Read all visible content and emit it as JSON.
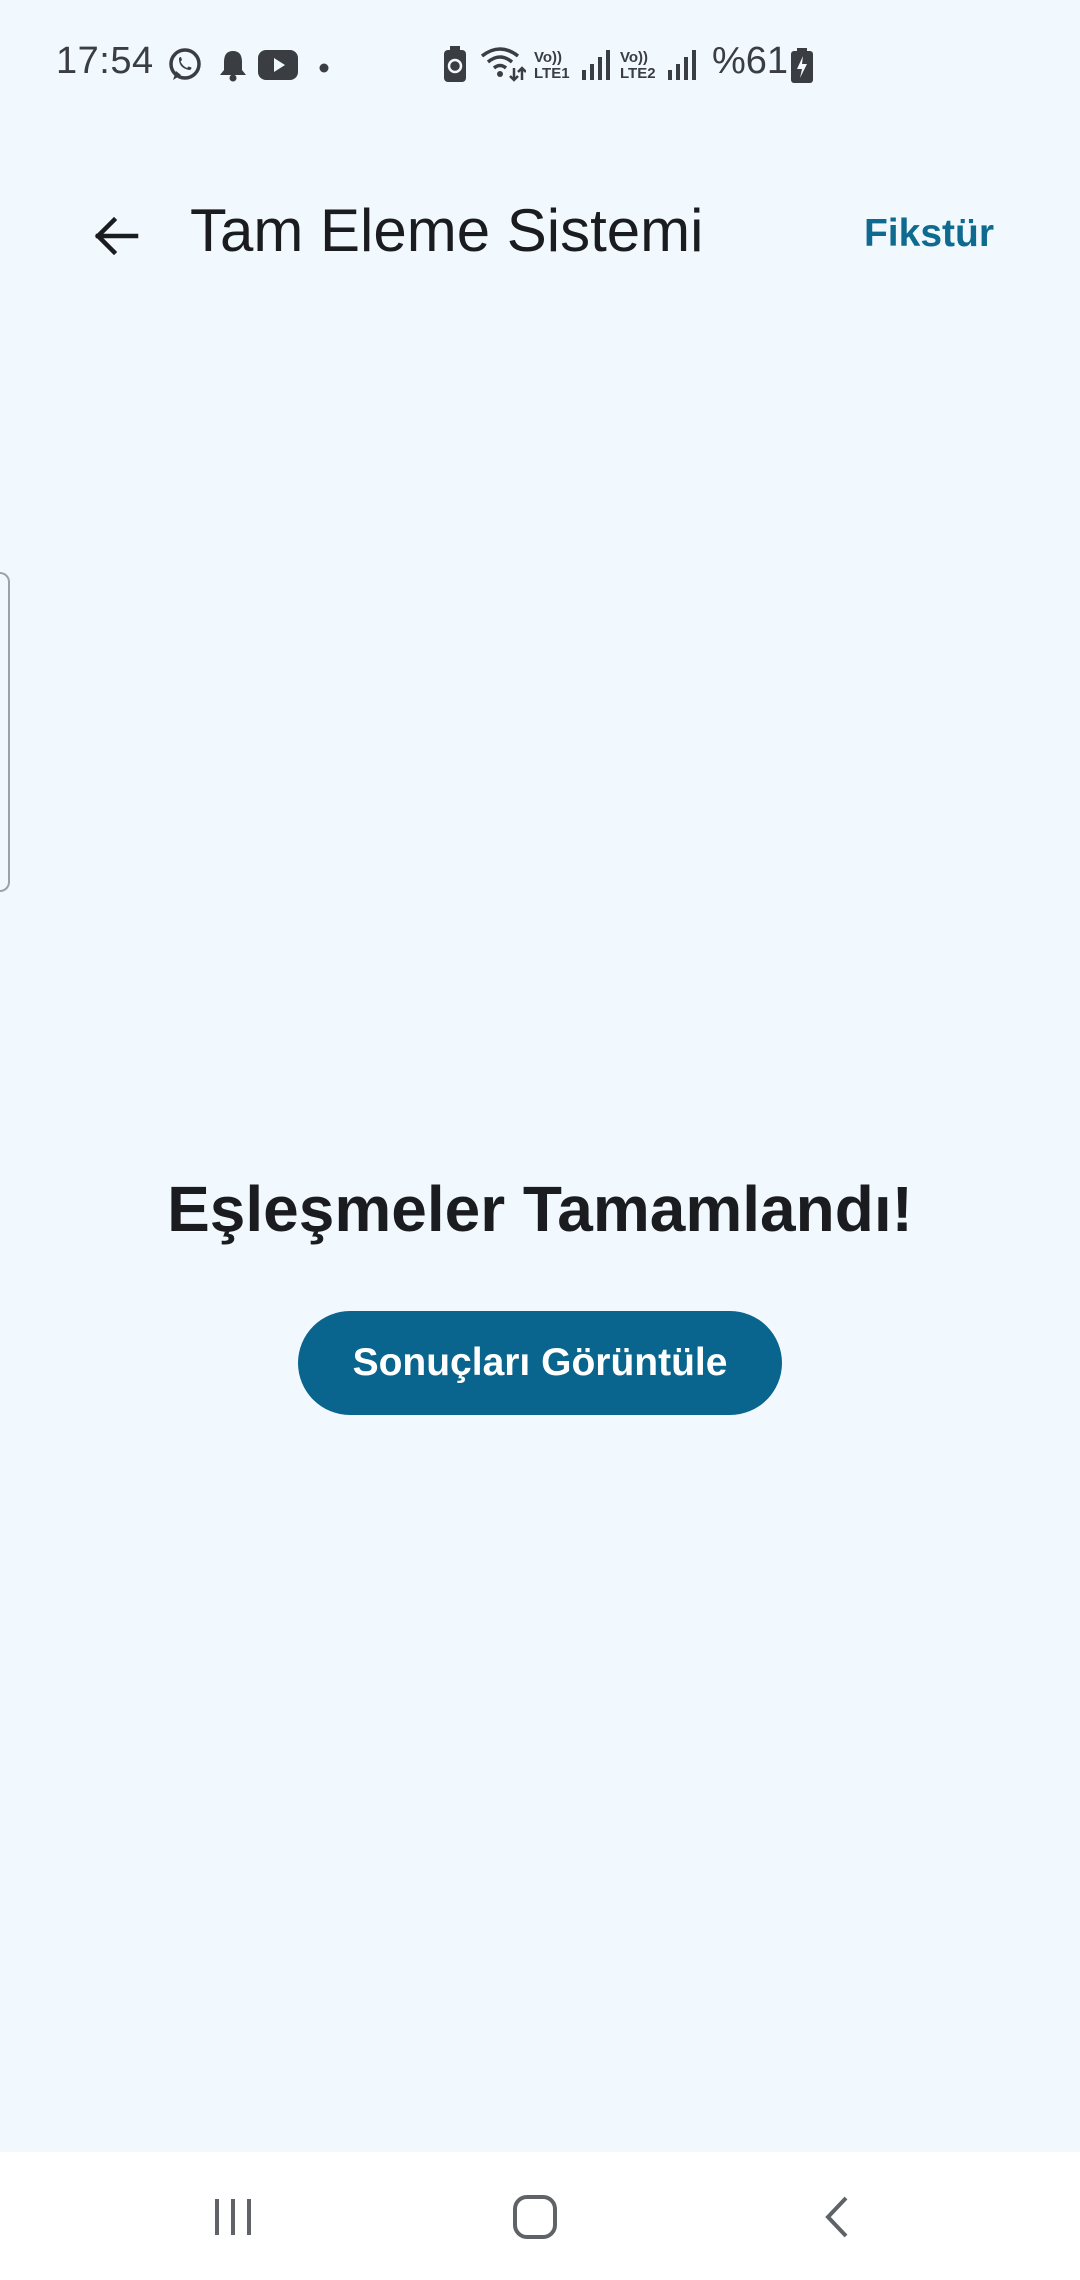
{
  "status_bar": {
    "time": "17:54",
    "battery_text": "%61",
    "sim1_volte": "Vo))",
    "sim1_label": "LTE1",
    "sim2_volte": "Vo))",
    "sim2_label": "LTE2",
    "icons": [
      "whatsapp-icon",
      "notification-bell-icon",
      "youtube-icon",
      "dot-icon",
      "battery-saver-icon",
      "wifi-icon",
      "signal-icon",
      "signal-icon",
      "battery-charging-icon"
    ]
  },
  "app_bar": {
    "title": "Tam Eleme Sistemi",
    "action_label": "Fikstür"
  },
  "content": {
    "headline": "Eşleşmeler Tamamlandı!",
    "button_label": "Sonuçları Görüntüle"
  },
  "colors": {
    "background": "#f2f9fe",
    "accent": "#09658d",
    "link": "#0e6a8f",
    "text": "#1b1c1f"
  },
  "nav_bar": {
    "icons": [
      "recent-apps-icon",
      "home-icon",
      "back-nav-icon"
    ]
  }
}
